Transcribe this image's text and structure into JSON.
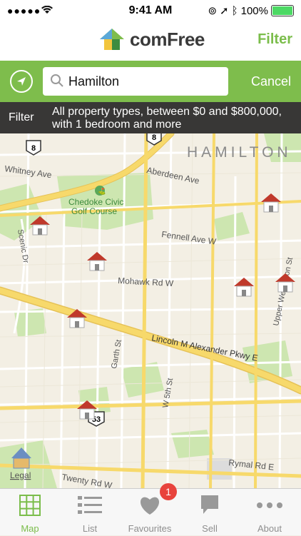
{
  "status_bar": {
    "carrier": "●●●●● ",
    "time": "9:41 AM",
    "battery": "100%"
  },
  "header": {
    "brand": "comFree",
    "filter_label": "Filter"
  },
  "search": {
    "value": "Hamilton",
    "cancel_label": "Cancel"
  },
  "filter_bar": {
    "label": "Filter",
    "description": "All property types, between $0 and $800,000, with 1 bedroom and more"
  },
  "map": {
    "city_label": "HAMILTON",
    "streets": [
      "Whitney Ave",
      "Aberdeen Ave",
      "Fennell Ave W",
      "Mohawk Rd W",
      "Upper Wellington St",
      "Lincoln M Alexander Pkwy E",
      "Garth St",
      "W 5th St",
      "Scenic Dr",
      "Rymal Rd E",
      "Twenty Rd W"
    ],
    "golf_course": "Chedoke Civic\nGolf Course",
    "highway_shields": [
      "8",
      "8",
      "53"
    ],
    "legal_label": "Legal",
    "listing_count": 9
  },
  "tabs": [
    {
      "label": "Map"
    },
    {
      "label": "List"
    },
    {
      "label": "Favourites",
      "badge": "1"
    },
    {
      "label": "Sell"
    },
    {
      "label": "About"
    }
  ],
  "colors": {
    "brand_green": "#7ebd4c",
    "badge_red": "#e8433c",
    "road_yellow": "#f7d96b"
  }
}
